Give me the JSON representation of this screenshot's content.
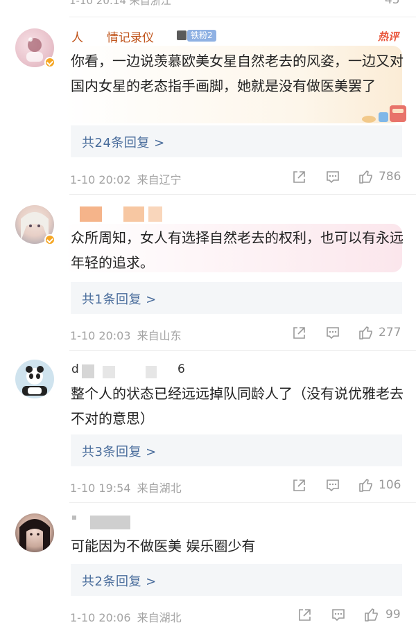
{
  "top_partial": {
    "meta": "1-10 20:14 来自浙江",
    "likes": "45"
  },
  "comments": [
    {
      "username": "人　　情记录仪",
      "fan_badge": "铁粉2",
      "hot_tag": "热评",
      "text": "你看，一边说羡慕欧美女星自然老去的风姿，一边又对国内女星的老态指手画脚，她就是没有做医美罢了",
      "replies": "共24条回复 >",
      "time": "1-10 20:02",
      "location": "来自辽宁",
      "likes": "786"
    },
    {
      "username": "",
      "text": "众所周知，女人有选择自然老去的权利，也可以有永远年轻的追求。",
      "replies": "共1条回复 >",
      "time": "1-10 20:03",
      "location": "来自山东",
      "likes": "277"
    },
    {
      "username_start": "d",
      "username_end": "6",
      "text": "整个人的状态已经远远掉队同龄人了（没有说优雅老去不对的意思）",
      "replies": "共3条回复 >",
      "time": "1-10 19:54",
      "location": "来自湖北",
      "likes": "106"
    },
    {
      "username": "",
      "text": "可能因为不做医美 娱乐圈少有",
      "replies": "共2条回复 >",
      "time": "1-10 20:06",
      "location": "来自湖北",
      "likes": "99"
    }
  ],
  "icons": [
    "share-icon",
    "comment-icon",
    "like-icon",
    "verified-icon"
  ],
  "colors": {
    "link": "#4a6d9c",
    "hot": "#e8543a",
    "meta": "#a3a3a3",
    "verified": "#f5a623"
  }
}
